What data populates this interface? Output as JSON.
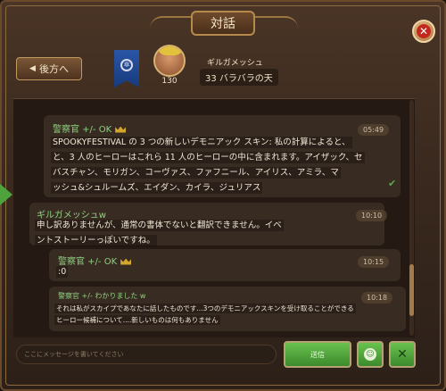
{
  "window": {
    "title": "対話"
  },
  "header": {
    "back_label": "後方へ",
    "player": {
      "name": "ギルガメッシュ",
      "status": "33 バラバラの天",
      "level": "130"
    }
  },
  "messages": [
    {
      "name": "警察官 +/- OK",
      "time": "05:49",
      "lines": [
        "SPOOKYFESTIVAL の 3 つの新しいデモニアック スキン: 私の計算によると、",
        "と、3 人のヒーローはこれら 11 人のヒーローの中に含まれます。アイザック、セ",
        "バスチャン、モリガン、コーヴァス、ファフニール、アイリス、アミラ、マ",
        "ッシュ&シュルームズ、エイダン、カイラ、ジュリアス"
      ]
    },
    {
      "name": "ギルガメッシュw",
      "time": "10:10",
      "lines": [
        "申し訳ありませんが、通常の書体でないと翻訳できません。イベ",
        "ントストーリーっぽいですね。"
      ]
    },
    {
      "name": "警察官 +/- OK",
      "time": "10:15",
      "lines": [
        ":0"
      ]
    },
    {
      "name": "警察官 +/- わかりました w",
      "time": "10:18",
      "lines": [
        "それは私がスカイプであなたに話したものです...3つのデモニアックスキンを受け取ることができる",
        "ヒーロー候補について....新しいものは何もありません"
      ]
    }
  ],
  "input": {
    "placeholder": "ここにメッセージを書いてください"
  },
  "footer": {
    "send_label": "送信"
  },
  "colors": {
    "accent": "#4ea33d",
    "name_green": "#8fd180",
    "panel": "#382b22"
  }
}
